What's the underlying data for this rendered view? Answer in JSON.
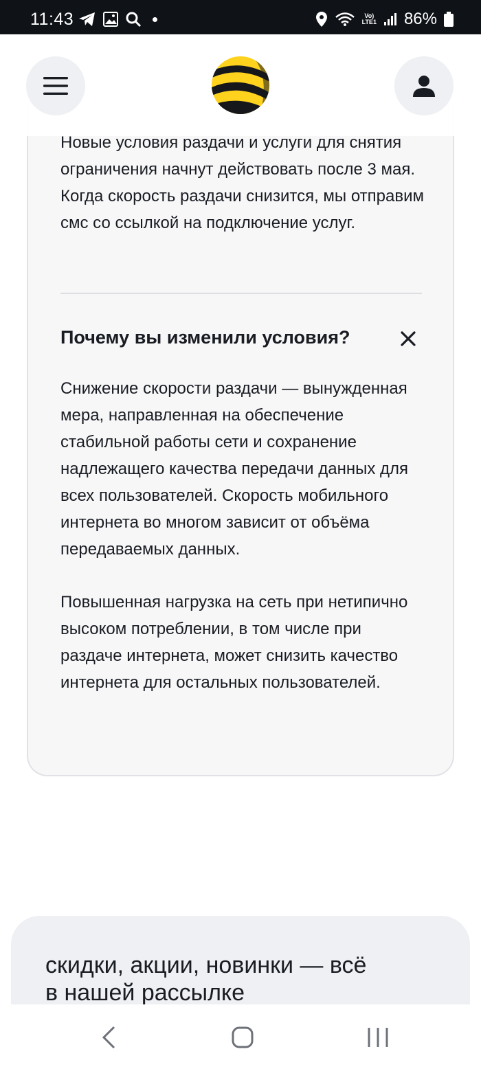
{
  "status_bar": {
    "time": "11:43",
    "battery": "86%",
    "network_top": "Vo)",
    "network_bottom": "LTE1",
    "icons": [
      "telegram-icon",
      "gallery-icon",
      "search-icon",
      "location-icon",
      "wifi-icon",
      "signal-icon",
      "battery-icon"
    ]
  },
  "header": {
    "menu_icon": "hamburger-menu-icon",
    "logo": "beeline-logo",
    "profile_icon": "user-icon"
  },
  "card": {
    "top_paragraph": "Новые условия раздачи и услуги для снятия ограничения начнут действовать после 3 мая. Когда скорость раздачи снизится, мы отправим смс со ссылкой на подключение услуг.",
    "question": "Почему вы изменили условия?",
    "answer_paragraph_1": "Снижение скорости раздачи — вынужденная мера, направленная на обеспечение стабильной работы сети и сохранение надлежащего качества передачи данных для всех пользователей. Скорость мобильного интернета во многом зависит от объёма передаваемых данных.",
    "answer_paragraph_2": "Повышенная нагрузка на сеть при нетипично высоком потреблении, в том числе при раздаче интернета, может снизить качество интернета для остальных пользователей."
  },
  "subscribe": {
    "title": "скидки, акции, новинки — всё в нашей рассылке"
  },
  "colors": {
    "accent_yellow": "#ffd21e",
    "text": "#191c22",
    "card_bg": "#f7f7f8",
    "button_bg": "#eef0f3"
  }
}
